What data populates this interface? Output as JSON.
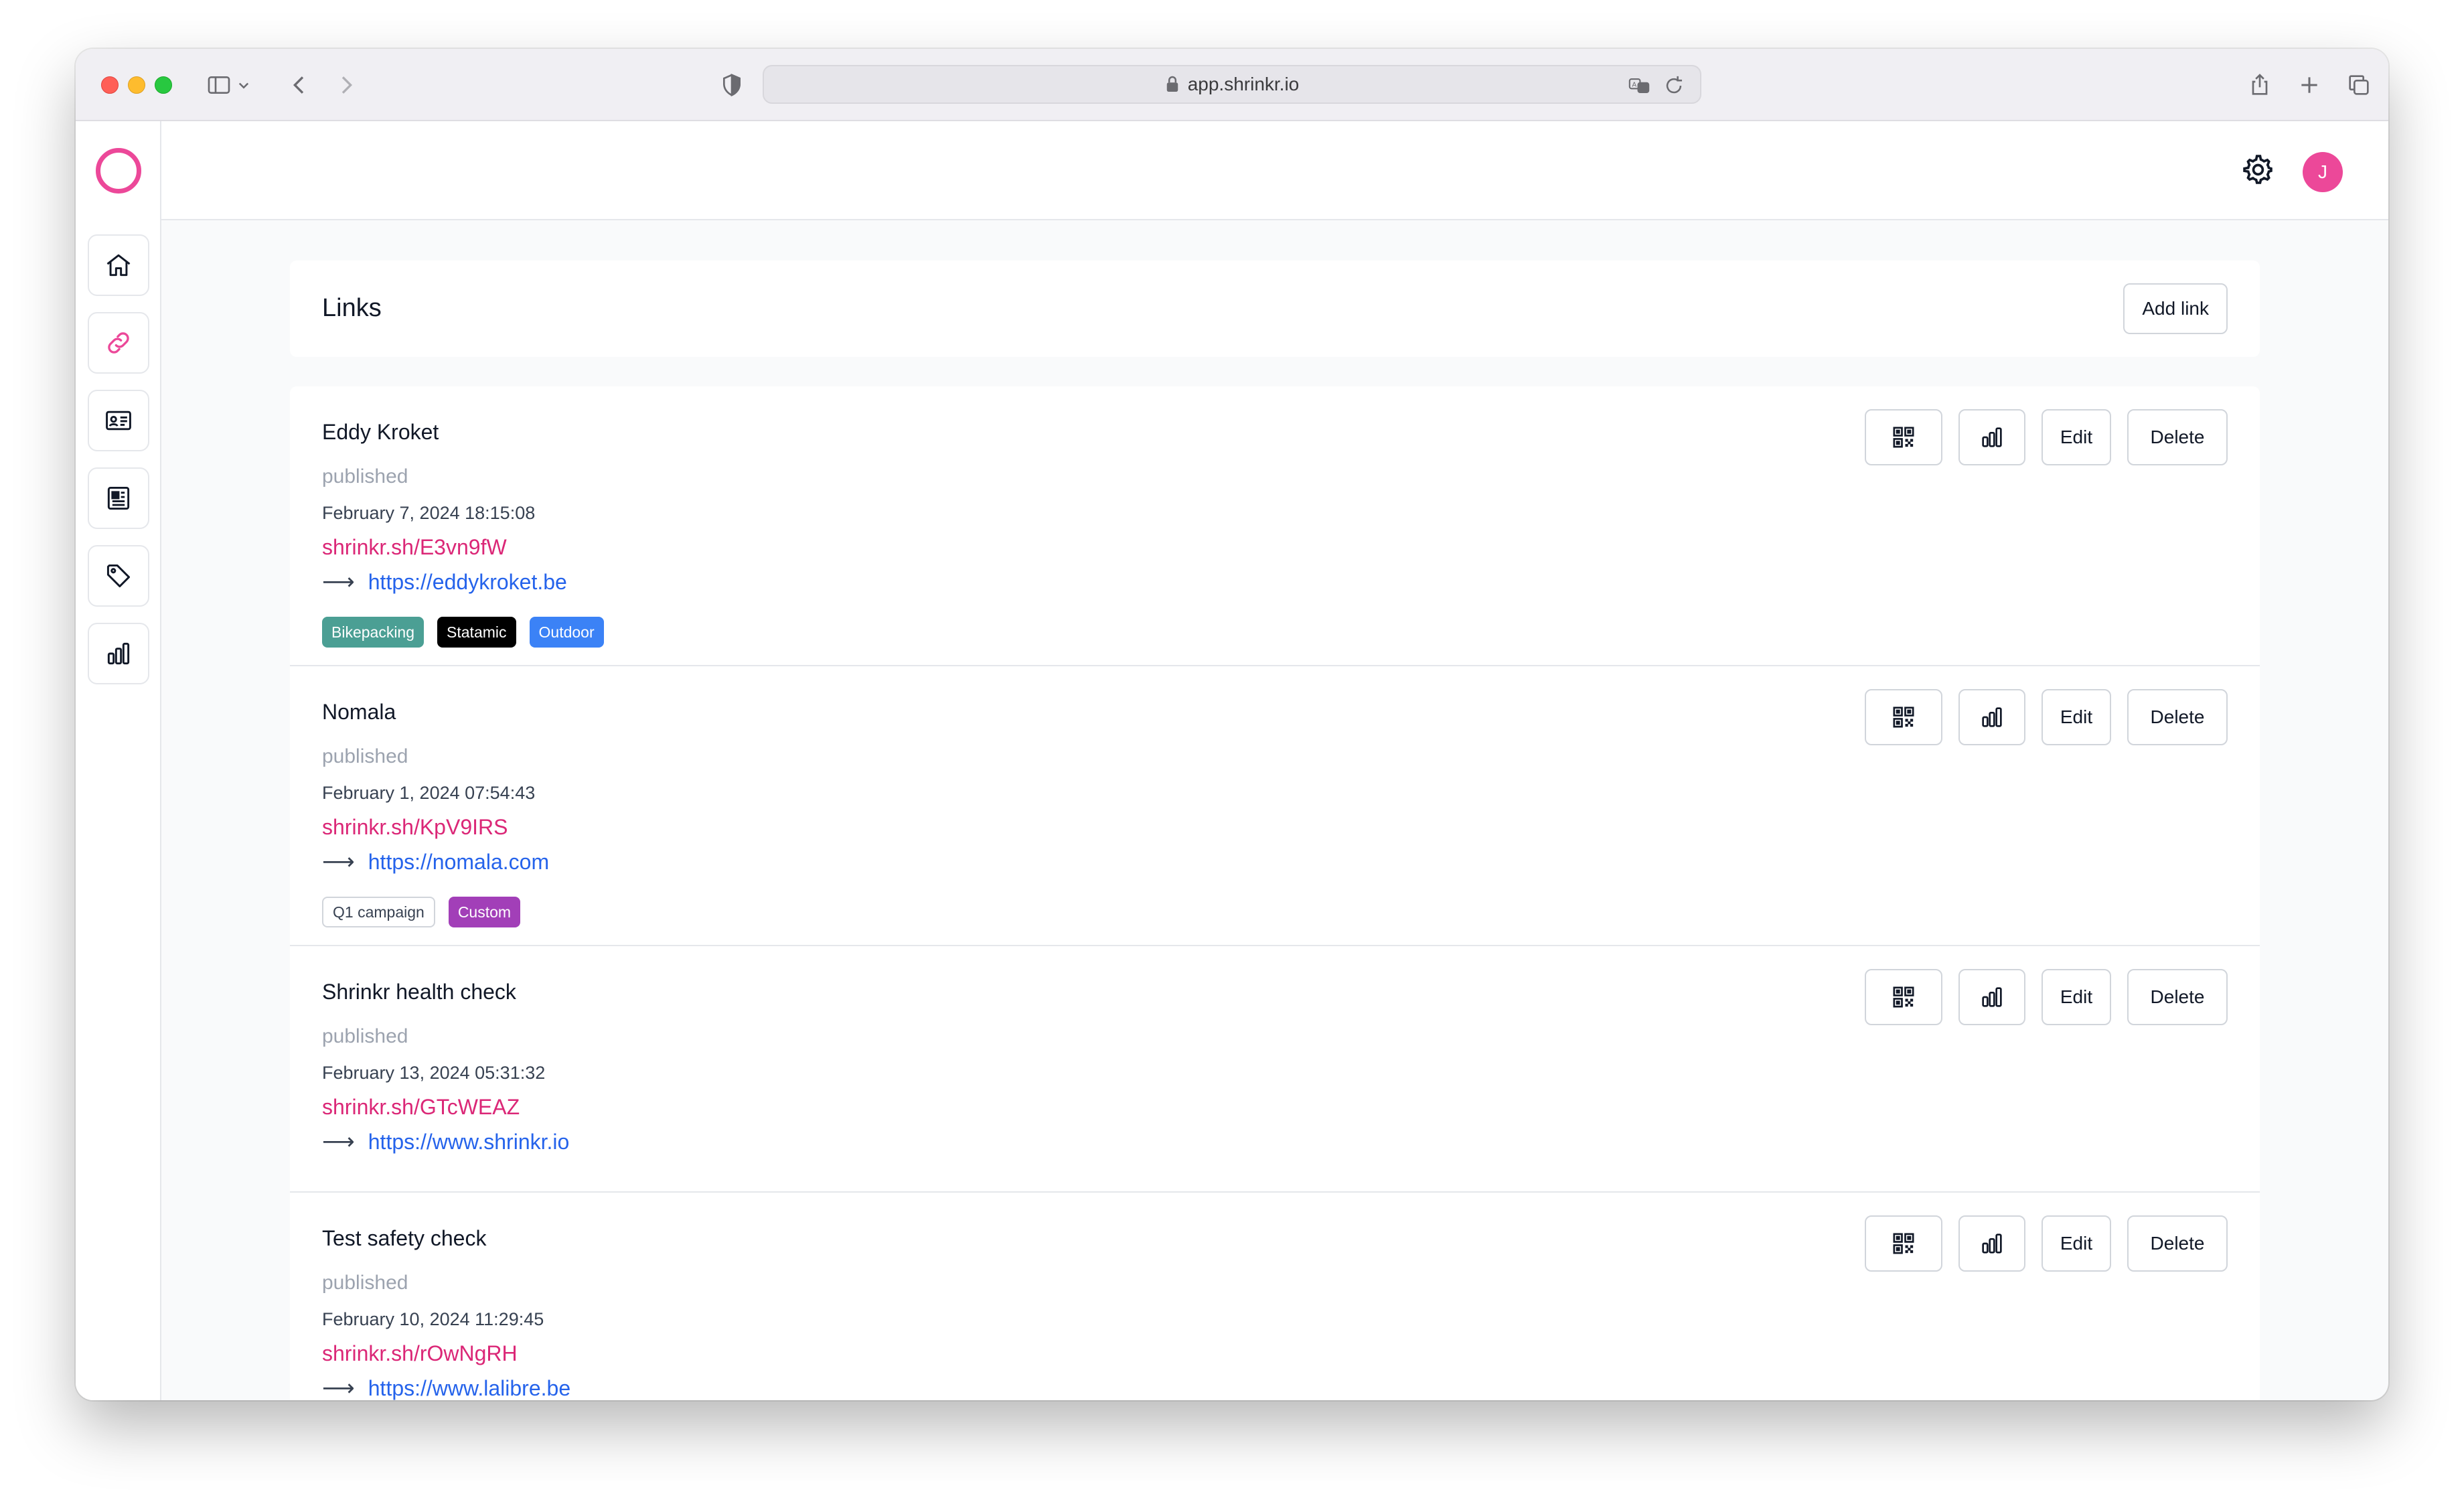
{
  "browser": {
    "url": "app.shrinkr.io"
  },
  "header": {
    "avatar_initial": "J"
  },
  "page": {
    "title": "Links",
    "add_button": "Add link"
  },
  "actions": {
    "edit": "Edit",
    "delete": "Delete"
  },
  "links": [
    {
      "title": "Eddy Kroket",
      "status": "published",
      "date": "February 7, 2024 18:15:08",
      "short_url": "shrinkr.sh/E3vn9fW",
      "destination": "https://eddykroket.be",
      "tags": [
        {
          "label": "Bikepacking",
          "color": "#4b9f94"
        },
        {
          "label": "Statamic",
          "color": "#000000"
        },
        {
          "label": "Outdoor",
          "color": "#3b82f6"
        }
      ]
    },
    {
      "title": "Nomala",
      "status": "published",
      "date": "February 1, 2024 07:54:43",
      "short_url": "shrinkr.sh/KpV9IRS",
      "destination": "https://nomala.com",
      "tags": [
        {
          "label": "Q1 campaign",
          "color": "#ffffff"
        },
        {
          "label": "Custom",
          "color": "#a23fb8"
        }
      ]
    },
    {
      "title": "Shrinkr health check",
      "status": "published",
      "date": "February 13, 2024 05:31:32",
      "short_url": "shrinkr.sh/GTcWEAZ",
      "destination": "https://www.shrinkr.io",
      "tags": []
    },
    {
      "title": "Test safety check",
      "status": "published",
      "date": "February 10, 2024 11:29:45",
      "short_url": "shrinkr.sh/rOwNgRH",
      "destination": "https://www.lalibre.be",
      "tags": []
    }
  ]
}
